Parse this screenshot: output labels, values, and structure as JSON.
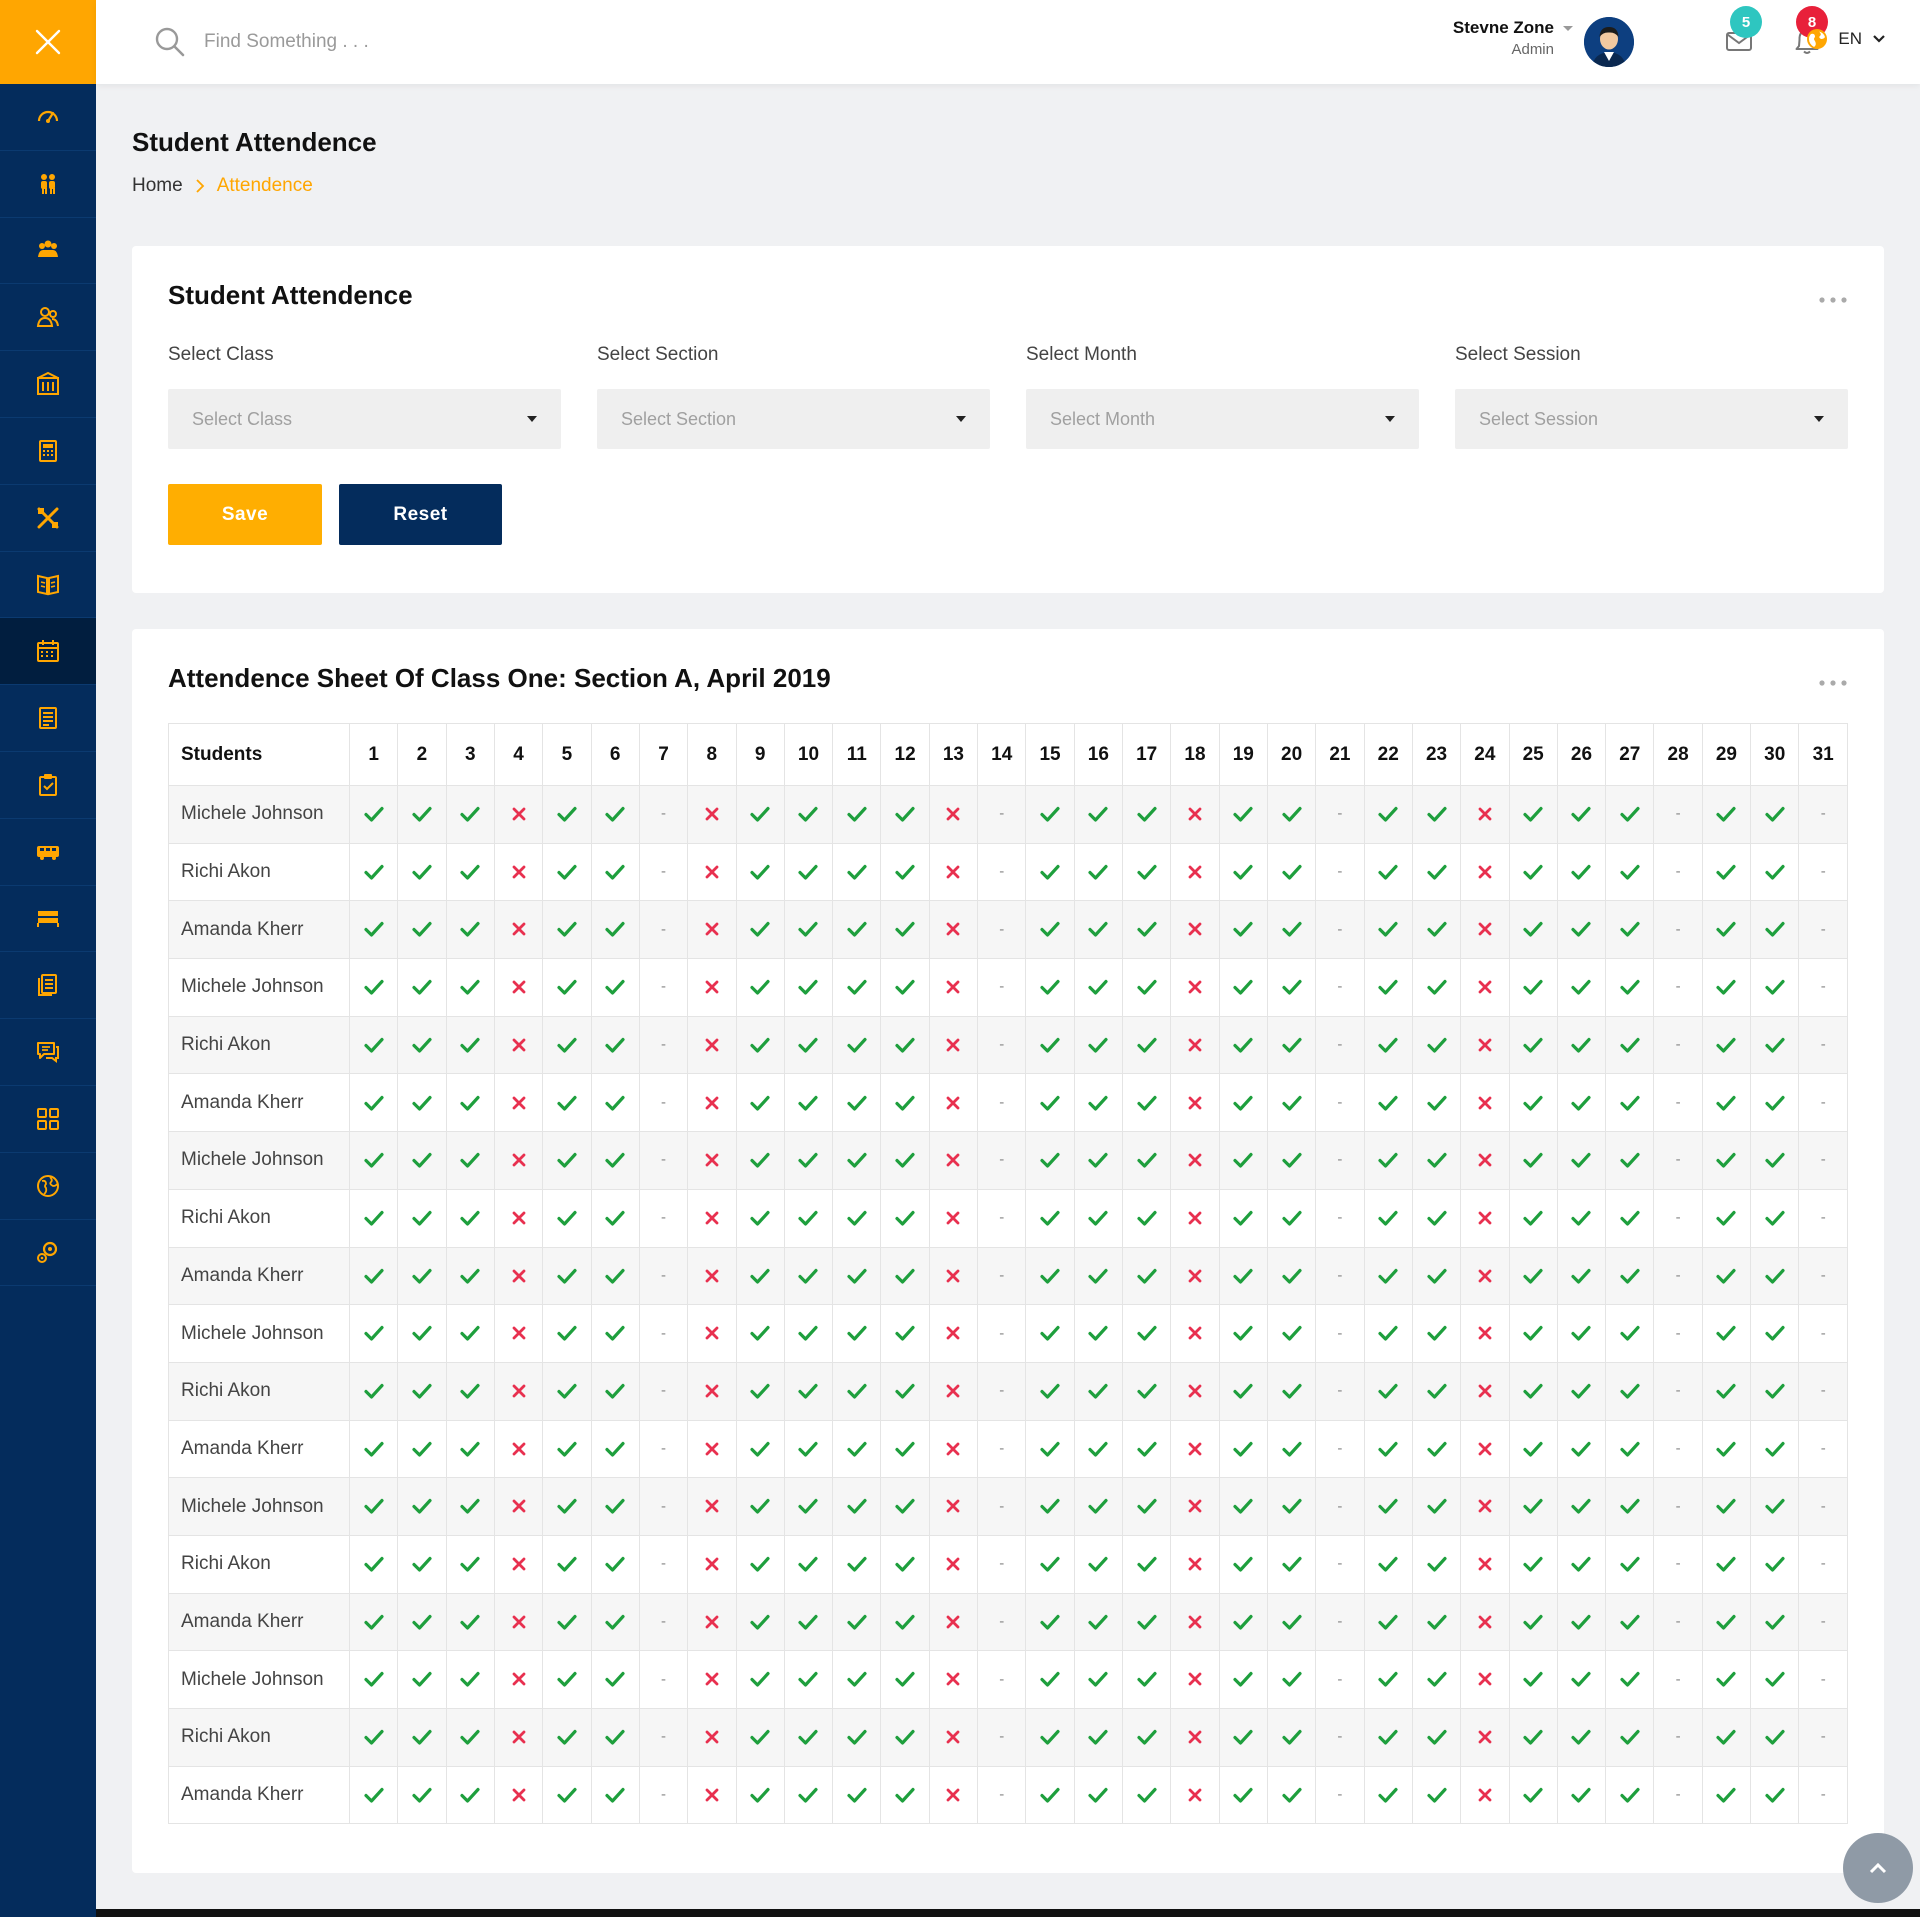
{
  "colors": {
    "accent": "#ffa601",
    "navy": "#042c5c",
    "present": "#1e9f3d",
    "absent": "#e8304f",
    "badge_mail": "#2ec6c0",
    "badge_bell": "#e8203a"
  },
  "header": {
    "search_placeholder": "Find Something . . .",
    "user_name": "Stevne Zone",
    "user_role": "Admin",
    "mail_badge": "5",
    "bell_badge": "8",
    "language": "EN"
  },
  "sidebar": {
    "toggle_icon": "close-icon",
    "items": [
      {
        "icon": "dashboard-icon"
      },
      {
        "icon": "students-icon"
      },
      {
        "icon": "parents-icon"
      },
      {
        "icon": "teachers-icon"
      },
      {
        "icon": "library-icon"
      },
      {
        "icon": "account-icon"
      },
      {
        "icon": "subject-icon"
      },
      {
        "icon": "class-routine-icon"
      },
      {
        "icon": "attendance-icon"
      },
      {
        "icon": "exam-icon"
      },
      {
        "icon": "exam-results-icon"
      },
      {
        "icon": "transport-icon"
      },
      {
        "icon": "hostel-icon"
      },
      {
        "icon": "notice-icon"
      },
      {
        "icon": "message-icon"
      },
      {
        "icon": "ui-elements-icon"
      },
      {
        "icon": "map-icon"
      },
      {
        "icon": "settings-icon"
      }
    ]
  },
  "page": {
    "title": "Student Attendence",
    "breadcrumb": {
      "home": "Home",
      "current": "Attendence"
    }
  },
  "form_card": {
    "title": "Student Attendence",
    "fields": [
      {
        "label": "Select Class",
        "value": "Select Class"
      },
      {
        "label": "Select Section",
        "value": "Select Section"
      },
      {
        "label": "Select Month",
        "value": "Select Month"
      },
      {
        "label": "Select Session",
        "value": "Select Session"
      }
    ],
    "save_label": "Save",
    "reset_label": "Reset"
  },
  "sheet": {
    "title": "Attendence Sheet Of Class One: Section A, April 2019",
    "students_header": "Students",
    "days": [
      "1",
      "2",
      "3",
      "4",
      "5",
      "6",
      "7",
      "8",
      "9",
      "10",
      "11",
      "12",
      "13",
      "14",
      "15",
      "16",
      "17",
      "18",
      "19",
      "20",
      "21",
      "22",
      "23",
      "24",
      "25",
      "26",
      "27",
      "28",
      "29",
      "30",
      "31"
    ],
    "pattern": [
      "P",
      "P",
      "P",
      "A",
      "P",
      "P",
      "-",
      "A",
      "P",
      "P",
      "P",
      "P",
      "A",
      "-",
      "P",
      "P",
      "P",
      "A",
      "P",
      "P",
      "-",
      "P",
      "P",
      "A",
      "P",
      "P",
      "P",
      "-",
      "P",
      "P",
      "-"
    ],
    "students": [
      "Michele Johnson",
      "Richi Akon",
      "Amanda Kherr",
      "Michele Johnson",
      "Richi Akon",
      "Amanda Kherr",
      "Michele Johnson",
      "Richi Akon",
      "Amanda Kherr",
      "Michele Johnson",
      "Richi Akon",
      "Amanda Kherr",
      "Michele Johnson",
      "Richi Akon",
      "Amanda Kherr",
      "Michele Johnson",
      "Richi Akon",
      "Amanda Kherr"
    ]
  }
}
